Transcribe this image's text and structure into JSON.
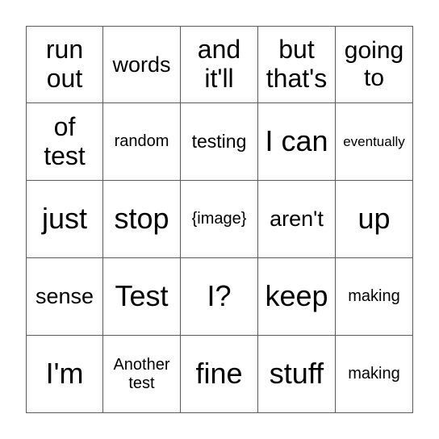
{
  "board": {
    "rows": [
      [
        "run\nout",
        "words",
        "and\nit'll",
        "but\nthat's",
        "going\nto"
      ],
      [
        "of\ntest",
        "random",
        "testing",
        "I can",
        "eventually"
      ],
      [
        "just",
        "stop",
        "{image}",
        "aren't",
        "up"
      ],
      [
        "sense",
        "Test",
        "I?",
        "keep",
        "making"
      ],
      [
        "I'm",
        "Another\ntest",
        "fine",
        "stuff",
        "making"
      ]
    ]
  }
}
